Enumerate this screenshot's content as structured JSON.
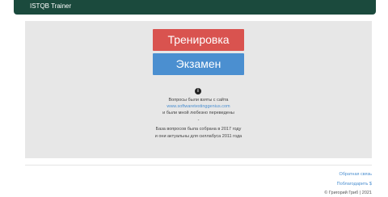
{
  "navbar": {
    "brand": "ISTQB Trainer"
  },
  "main": {
    "training_label": "Тренировка",
    "exam_label": "Экзамен",
    "info_icon_glyph": "i",
    "source_line": "Вопросы были взяты с сайта",
    "source_link": "www.softwaretestinggenius.com",
    "translated_line": "и были мной любезно переведены",
    "separator": "-",
    "collected_line": "База вопросов была собрана в 2017 году",
    "syllabus_line": "и они актуальны для силлабуса 2011 года"
  },
  "footer": {
    "feedback_link": "Обратная связь",
    "thanks_link": "Поблагодарить $",
    "copyright": "© Григорий Гриб | 2021"
  },
  "colors": {
    "navbar": "#1b4a3d",
    "panel": "#e7e7e7",
    "training_button": "#d9534f",
    "exam_button": "#4b8fd0",
    "link": "#4b8fd0"
  },
  "icons": [
    "info-icon"
  ]
}
